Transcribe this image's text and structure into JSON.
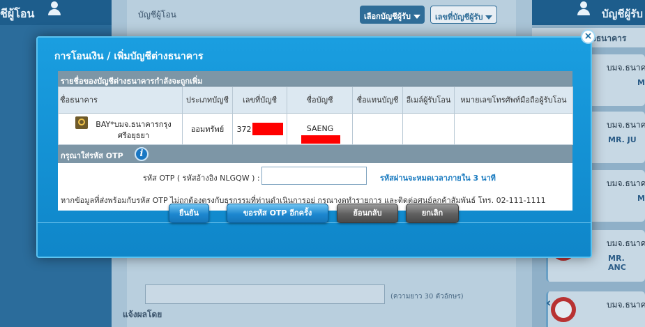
{
  "background": {
    "left_header": "ชีผู้โอน",
    "center_label_account": "บัญชีผู้โอน",
    "select_recipient": "เลือกบัญชีผู้รับ",
    "select_account_no": "เลขที่บัญชีผู้รับ",
    "length_hint": "(ความยาว 30 ตัวอักษร)",
    "notify_label": "แจ้งผลโดย",
    "right_header": "บัญชีผู้รับ",
    "right_sub": "งธนาคาร",
    "cards": [
      {
        "t1": "บมจ.ธนาค",
        "t2": "MI"
      },
      {
        "t1": "บมจ.ธนาค",
        "t2": "MR. JU"
      },
      {
        "t1": "บมจ.ธนาค",
        "t2": "MI"
      },
      {
        "t1": "บมจ.ธนาค",
        "t2": "MR. ANC"
      },
      {
        "t1": "บมจ.ธนาค",
        "t2": ""
      }
    ],
    "nav_arrow": "‹"
  },
  "modal": {
    "title": "การโอนเงิน / เพิ่มบัญชีต่างธนาคาร",
    "close_label": "×",
    "section_title": "รายชื่อของบัญชีต่างธนาคารกำลังจะถูกเพิ่ม",
    "columns": [
      "ชื่อธนาคาร",
      "ประเภทบัญชี",
      "เลขที่บัญชี",
      "ชื่อบัญชี",
      "ชื่อแทนบัญชี",
      "อีเมล์ผู้รับโอน",
      "หมายเลขโทรศัพท์มือถือผู้รับโอน"
    ],
    "row": {
      "bank": "BAY*บมจ.ธนาคารกรุงศรีอยุธยา",
      "account_type": "ออมทรัพย์",
      "account_no_prefix": "372",
      "account_name": "SAENG",
      "alias": "",
      "email": "",
      "mobile": ""
    },
    "otp_section_title": "กรุณาใส่รหัส OTP",
    "otp_label": "รหัส OTP ( รหัสอ้างอิง NLGQW )  :",
    "otp_value": "",
    "otp_expire": "รหัสผ่านจะหมดเวลาภายใน 3 นาที",
    "otp_note": "หากข้อมูลที่ส่งพร้อมกับรหัส OTP ไม่ถูกต้องตรงกับธุรกรรมที่ท่านดำเนินการอยู่ กรุณางดทำรายการ และติดต่อศูนย์ลูกค้าสัมพันธ์ โทร. 02-111-1111",
    "buttons": {
      "confirm": "ยืนยัน",
      "request_otp": "ขอรหัส OTP อีกครั้ง",
      "back": "ย้อนกลับ",
      "cancel": "ยกเลิก"
    }
  },
  "colors": {
    "modal_bg": "#1a9ee0",
    "section_head": "#7d96a6",
    "redaction": "#ff0000",
    "expire_text": "#1a7bc0"
  }
}
